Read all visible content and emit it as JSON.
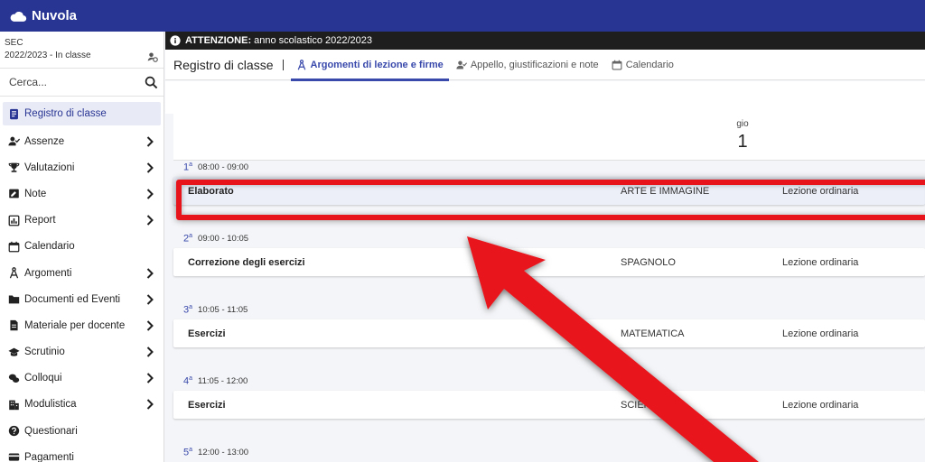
{
  "app": {
    "title": "Nuvola"
  },
  "context": {
    "school": "SEC",
    "year_class": "2022/2023 - In classe"
  },
  "search": {
    "placeholder": "Cerca..."
  },
  "sidebar": {
    "items": [
      {
        "label": "Registro di classe",
        "icon": "register-icon",
        "active": true,
        "chevron": false
      },
      {
        "label": "Assenze",
        "icon": "user-check-icon",
        "chevron": true
      },
      {
        "label": "Valutazioni",
        "icon": "trophy-icon",
        "chevron": true
      },
      {
        "label": "Note",
        "icon": "note-icon",
        "chevron": true
      },
      {
        "label": "Report",
        "icon": "report-icon",
        "chevron": true
      },
      {
        "label": "Calendario",
        "icon": "calendar-icon",
        "chevron": false
      },
      {
        "label": "Argomenti",
        "icon": "compass-icon",
        "chevron": true
      },
      {
        "label": "Documenti ed Eventi",
        "icon": "folder-icon",
        "chevron": true
      },
      {
        "label": "Materiale per docente",
        "icon": "file-icon",
        "chevron": true
      },
      {
        "label": "Scrutinio",
        "icon": "graduation-cap-icon",
        "chevron": true
      },
      {
        "label": "Colloqui",
        "icon": "chat-icon",
        "chevron": true
      },
      {
        "label": "Modulistica",
        "icon": "building-icon",
        "chevron": true
      },
      {
        "label": "Questionari",
        "icon": "question-icon",
        "chevron": false
      },
      {
        "label": "Pagamenti",
        "icon": "card-icon",
        "chevron": false
      }
    ]
  },
  "notice": {
    "label": "ATTENZIONE:",
    "text": "anno scolastico 2022/2023"
  },
  "header": {
    "title": "Registro di classe",
    "tabs": [
      {
        "label": "Argomenti di lezione e firme",
        "active": true
      },
      {
        "label": "Appello, giustificazioni e note",
        "active": false
      },
      {
        "label": "Calendario",
        "active": false
      }
    ]
  },
  "day": {
    "dow": "gio",
    "num": "1"
  },
  "slots": [
    {
      "ord": "1",
      "sup": "a",
      "time": "08:00 - 09:00",
      "topic": "Elaborato",
      "subject": "ARTE E IMMAGINE",
      "type": "Lezione ordinaria"
    },
    {
      "ord": "2",
      "sup": "a",
      "time": "09:00 - 10:05",
      "topic": "Correzione degli esercizi",
      "subject": "SPAGNOLO",
      "type": "Lezione ordinaria"
    },
    {
      "ord": "3",
      "sup": "a",
      "time": "10:05 - 11:05",
      "topic": "Esercizi",
      "subject": "MATEMATICA",
      "type": "Lezione ordinaria"
    },
    {
      "ord": "4",
      "sup": "a",
      "time": "11:05 - 12:00",
      "topic": "Esercizi",
      "subject": "SCIENZ",
      "type": "Lezione ordinaria"
    },
    {
      "ord": "5",
      "sup": "a",
      "time": "12:00 - 13:00"
    }
  ],
  "colors": {
    "brand": "#283593",
    "accent": "#3949ab",
    "highlight": "#e8141b"
  }
}
